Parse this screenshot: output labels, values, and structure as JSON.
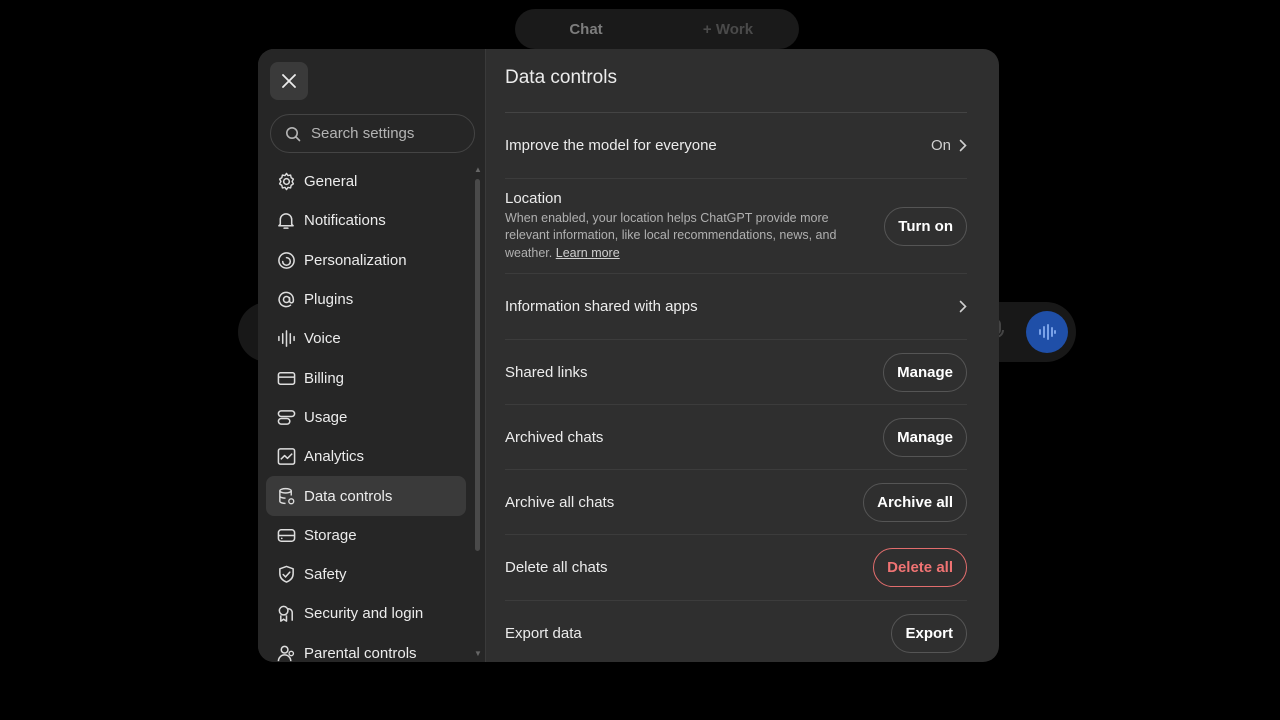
{
  "background": {
    "mode_tabs": [
      "Chat",
      "+ Work"
    ]
  },
  "sidebar": {
    "search_placeholder": "Search settings",
    "items": [
      {
        "label": "General",
        "icon": "gear-icon"
      },
      {
        "label": "Notifications",
        "icon": "bell-icon"
      },
      {
        "label": "Personalization",
        "icon": "personalization-icon"
      },
      {
        "label": "Plugins",
        "icon": "at-icon"
      },
      {
        "label": "Voice",
        "icon": "waveform-icon"
      },
      {
        "label": "Billing",
        "icon": "card-icon"
      },
      {
        "label": "Usage",
        "icon": "usage-icon"
      },
      {
        "label": "Analytics",
        "icon": "chart-icon"
      },
      {
        "label": "Data controls",
        "icon": "database-icon",
        "active": true
      },
      {
        "label": "Storage",
        "icon": "storage-icon"
      },
      {
        "label": "Safety",
        "icon": "shield-icon"
      },
      {
        "label": "Security and login",
        "icon": "lock-icon"
      },
      {
        "label": "Parental controls",
        "icon": "people-icon"
      }
    ]
  },
  "content": {
    "title": "Data controls",
    "improve": {
      "label": "Improve the model for everyone",
      "value": "On"
    },
    "location": {
      "label": "Location",
      "desc": "When enabled, your location helps ChatGPT provide more relevant information, like local recommendations, news, and weather.",
      "link": "Learn more",
      "button": "Turn on"
    },
    "info_shared": {
      "label": "Information shared with apps"
    },
    "shared_links": {
      "label": "Shared links",
      "button": "Manage"
    },
    "archived": {
      "label": "Archived chats",
      "button": "Manage"
    },
    "archive_all": {
      "label": "Archive all chats",
      "button": "Archive all"
    },
    "delete_all": {
      "label": "Delete all chats",
      "button": "Delete all"
    },
    "export": {
      "label": "Export data",
      "button": "Export"
    }
  },
  "colors": {
    "danger": "#f07373",
    "voice_button": "#1f4fa8"
  }
}
